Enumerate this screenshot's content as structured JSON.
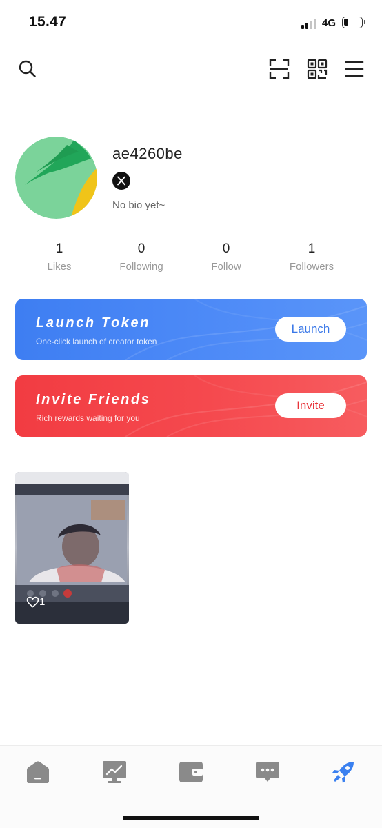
{
  "status_bar": {
    "time": "15.47",
    "network": "4G",
    "battery_level": 0.2
  },
  "top_nav": {
    "icons": [
      "search-icon",
      "scan-icon",
      "qr-code-icon",
      "menu-icon"
    ]
  },
  "profile": {
    "username": "ae4260be",
    "social_badge": "x-logo-icon",
    "bio": "No bio yet~"
  },
  "stats": [
    {
      "value": "1",
      "label": "Likes"
    },
    {
      "value": "0",
      "label": "Following"
    },
    {
      "value": "0",
      "label": "Follow"
    },
    {
      "value": "1",
      "label": "Followers"
    }
  ],
  "banners": {
    "launch": {
      "title": "Launch Token",
      "subtitle": "One-click launch of creator token",
      "button": "Launch",
      "color": "#4082f4"
    },
    "invite": {
      "title": "Invite Friends",
      "subtitle": "Rich rewards waiting for you",
      "button": "Invite",
      "color": "#f4434a"
    }
  },
  "posts": [
    {
      "likes": "1",
      "icon": "heart-icon"
    }
  ],
  "tab_bar": {
    "tabs": [
      "home-icon",
      "chart-icon",
      "wallet-icon",
      "chat-icon",
      "rocket-icon"
    ],
    "active_color": "#3a80f0",
    "inactive_color": "#8a8a8a"
  }
}
